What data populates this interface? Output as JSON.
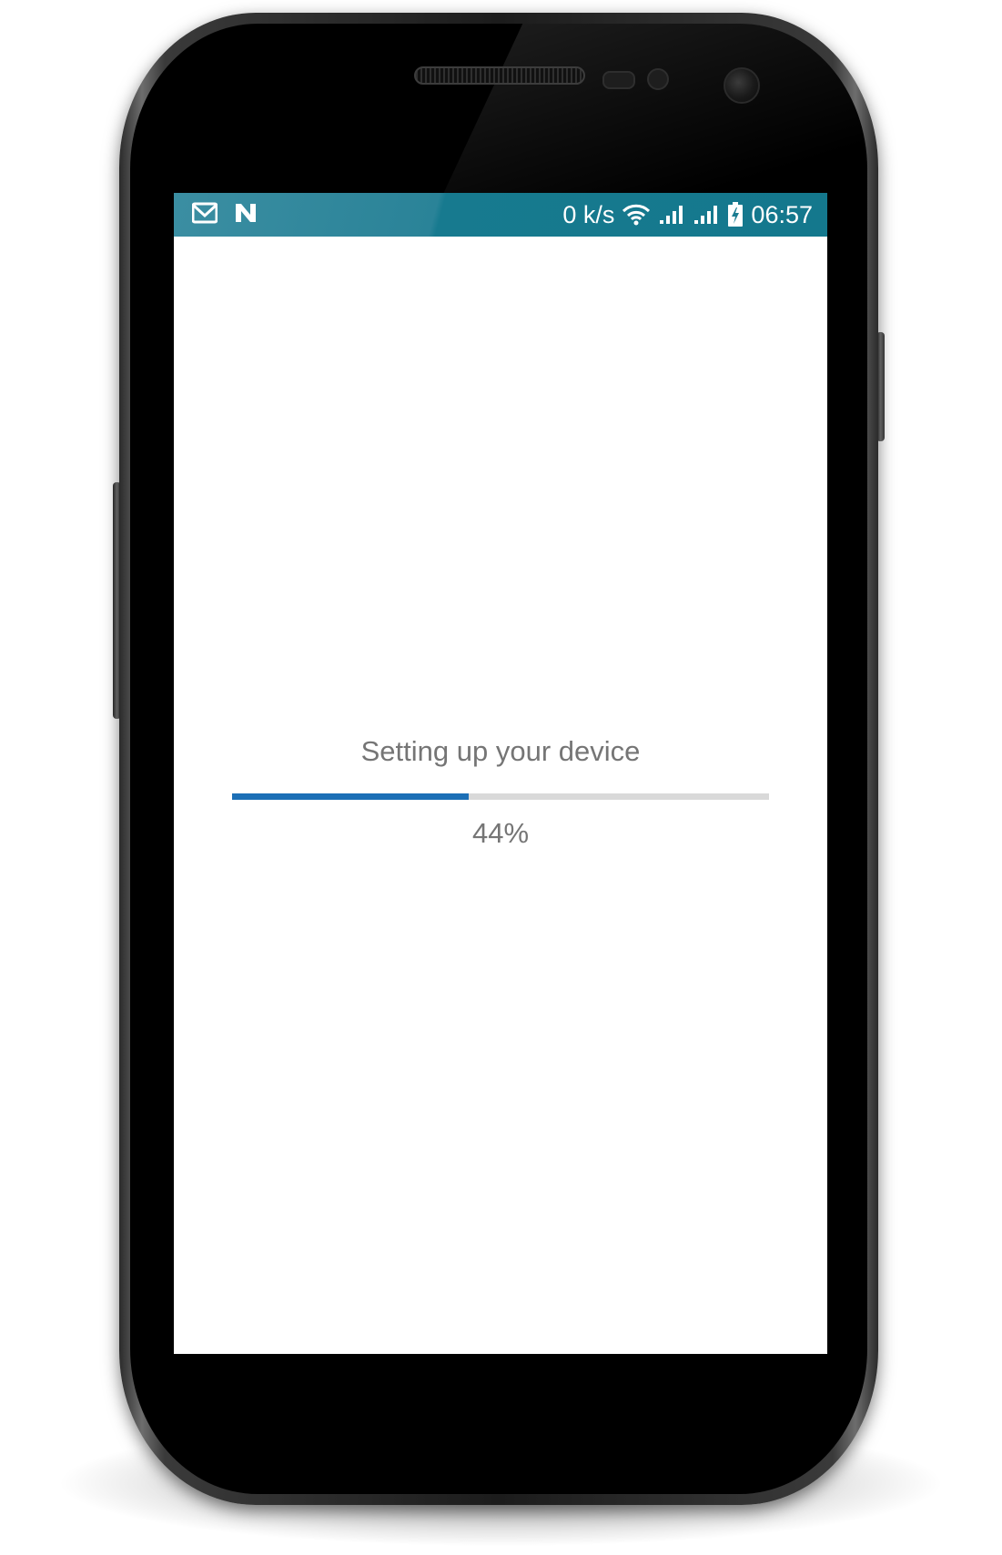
{
  "status_bar": {
    "notification_icons": [
      "gmail-icon",
      "n-icon"
    ],
    "network_speed": "0 k/s",
    "system_icons": [
      "wifi-icon",
      "signal-1-icon",
      "signal-2-icon",
      "battery-charging-icon"
    ],
    "time": "06:57",
    "background_color": "#1a7c91"
  },
  "setup": {
    "title": "Setting up your device",
    "progress_fraction": 0.44,
    "progress_label": "44%",
    "progress_color": "#1c6fb6",
    "track_color": "#d9d9d9"
  }
}
